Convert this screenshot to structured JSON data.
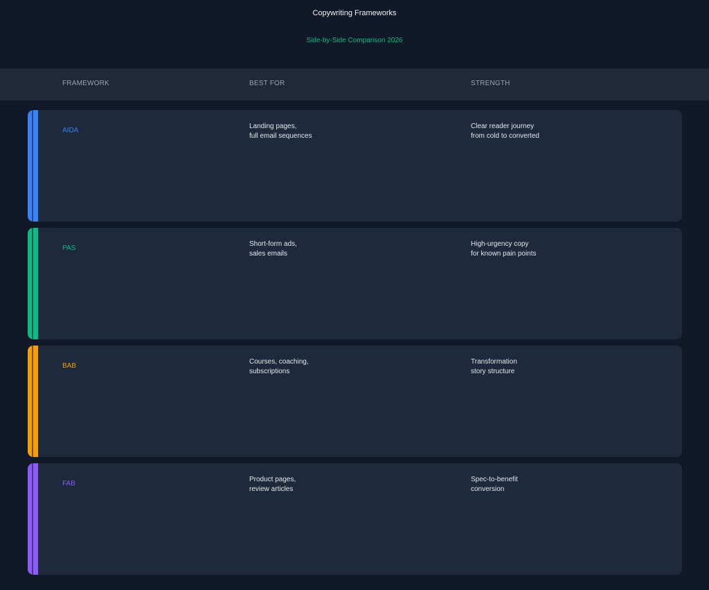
{
  "header": {
    "title": "Copywriting Frameworks",
    "subtitle": "Side-by-Side Comparison 2026"
  },
  "columns": {
    "framework": "FRAMEWORK",
    "best_for": "BEST FOR",
    "strength": "STRENGTH"
  },
  "colors": {
    "background": "#111827",
    "header_band": "#1f2937",
    "row_background": "#1e293b",
    "subtitle_accent": "#10b981"
  },
  "rows": [
    {
      "name": "AIDA",
      "color": "#3b82f6",
      "best_for": [
        "Landing pages,",
        "full email sequences"
      ],
      "strength": [
        "Clear reader journey",
        "from cold to converted"
      ]
    },
    {
      "name": "PAS",
      "color": "#10b981",
      "best_for": [
        "Short-form ads,",
        "sales emails"
      ],
      "strength": [
        "High-urgency copy",
        "for known pain points"
      ]
    },
    {
      "name": "BAB",
      "color": "#f59e0b",
      "best_for": [
        "Courses, coaching,",
        "subscriptions"
      ],
      "strength": [
        "Transformation",
        "story structure"
      ]
    },
    {
      "name": "FAB",
      "color": "#8b5cf6",
      "best_for": [
        "Product pages,",
        "review articles"
      ],
      "strength": [
        "Spec-to-benefit",
        "conversion"
      ]
    }
  ]
}
